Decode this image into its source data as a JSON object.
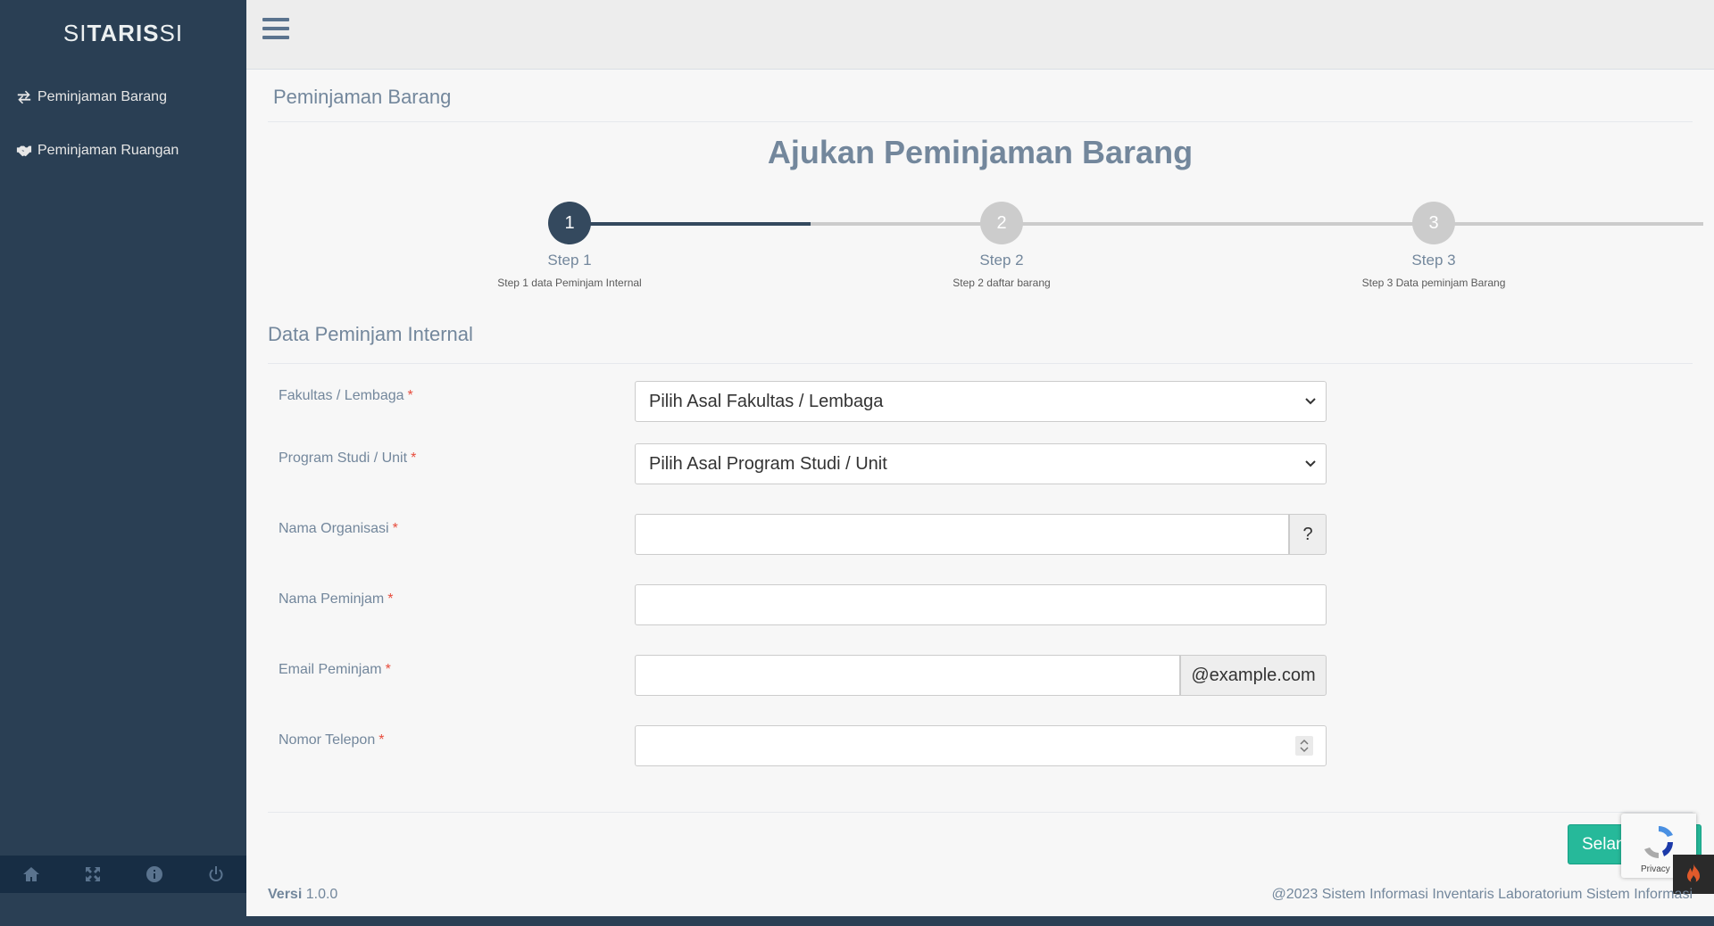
{
  "brand": {
    "part1": "SI",
    "part2": "TARIS",
    "part3": " SI"
  },
  "sidebar": {
    "items": [
      {
        "label": "Peminjaman Barang",
        "icon": "exchange-icon"
      },
      {
        "label": "Peminjaman Ruangan",
        "icon": "handshake-icon"
      }
    ],
    "footer_icons": [
      "home-icon",
      "fullscreen-icon",
      "info-icon",
      "power-icon"
    ]
  },
  "page": {
    "panel_title": "Peminjaman Barang",
    "heading": "Ajukan Peminjaman Barang"
  },
  "steps": [
    {
      "number": "1",
      "title": "Step 1",
      "desc": "Step 1 data Peminjam Internal",
      "active": true
    },
    {
      "number": "2",
      "title": "Step 2",
      "desc": "Step 2 daftar barang",
      "active": false
    },
    {
      "number": "3",
      "title": "Step 3",
      "desc": "Step 3 Data peminjam Barang",
      "active": false
    }
  ],
  "form": {
    "section_title": "Data Peminjam Internal",
    "required_mark": "*",
    "fakultas": {
      "label": "Fakultas / Lembaga",
      "value": "Pilih Asal Fakultas / Lembaga"
    },
    "prodi": {
      "label": "Program Studi / Unit",
      "value": "Pilih Asal Program Studi / Unit"
    },
    "organisasi": {
      "label": "Nama Organisasi",
      "value": "",
      "help": "?"
    },
    "peminjam": {
      "label": "Nama Peminjam",
      "value": ""
    },
    "email": {
      "label": "Email Peminjam",
      "value": "",
      "suffix": "@example.com"
    },
    "telepon": {
      "label": "Nomor Telepon",
      "value": ""
    },
    "next_label": "Selanjutnya"
  },
  "recaptcha": {
    "label": "Privacy"
  },
  "footer": {
    "version_label": "Versi",
    "version": "1.0.0",
    "copyright": "@2023 Sistem Informasi Inventaris Laboratorium Sistem Informasi"
  },
  "colors": {
    "sidebar": "#2a3f54",
    "accent": "#34495e",
    "success": "#26b99a",
    "text": "#73879c"
  }
}
